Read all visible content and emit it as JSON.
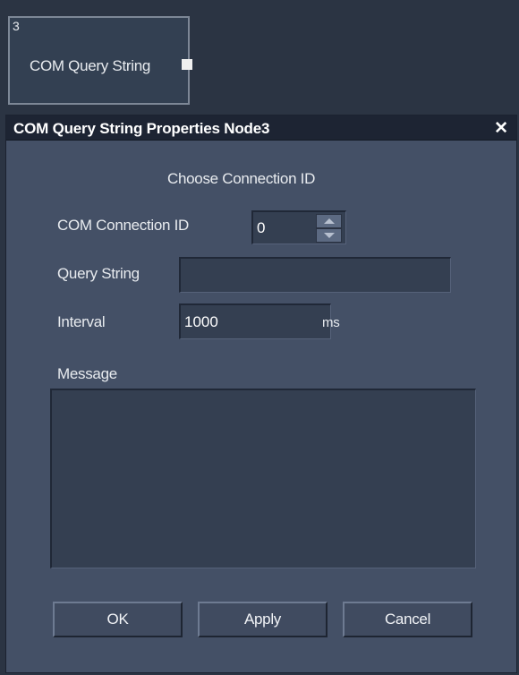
{
  "node": {
    "number": "3",
    "title": "COM Query String"
  },
  "dialog": {
    "title": "COM Query String Properties Node3",
    "close": "✕",
    "heading": "Choose Connection ID",
    "connection": {
      "label": "COM Connection ID",
      "value": "0"
    },
    "query": {
      "label": "Query String",
      "value": ""
    },
    "interval": {
      "label": "Interval",
      "value": "1000",
      "unit": "ms"
    },
    "message": {
      "label": "Message",
      "value": ""
    },
    "buttons": {
      "ok": "OK",
      "apply": "Apply",
      "cancel": "Cancel"
    }
  }
}
